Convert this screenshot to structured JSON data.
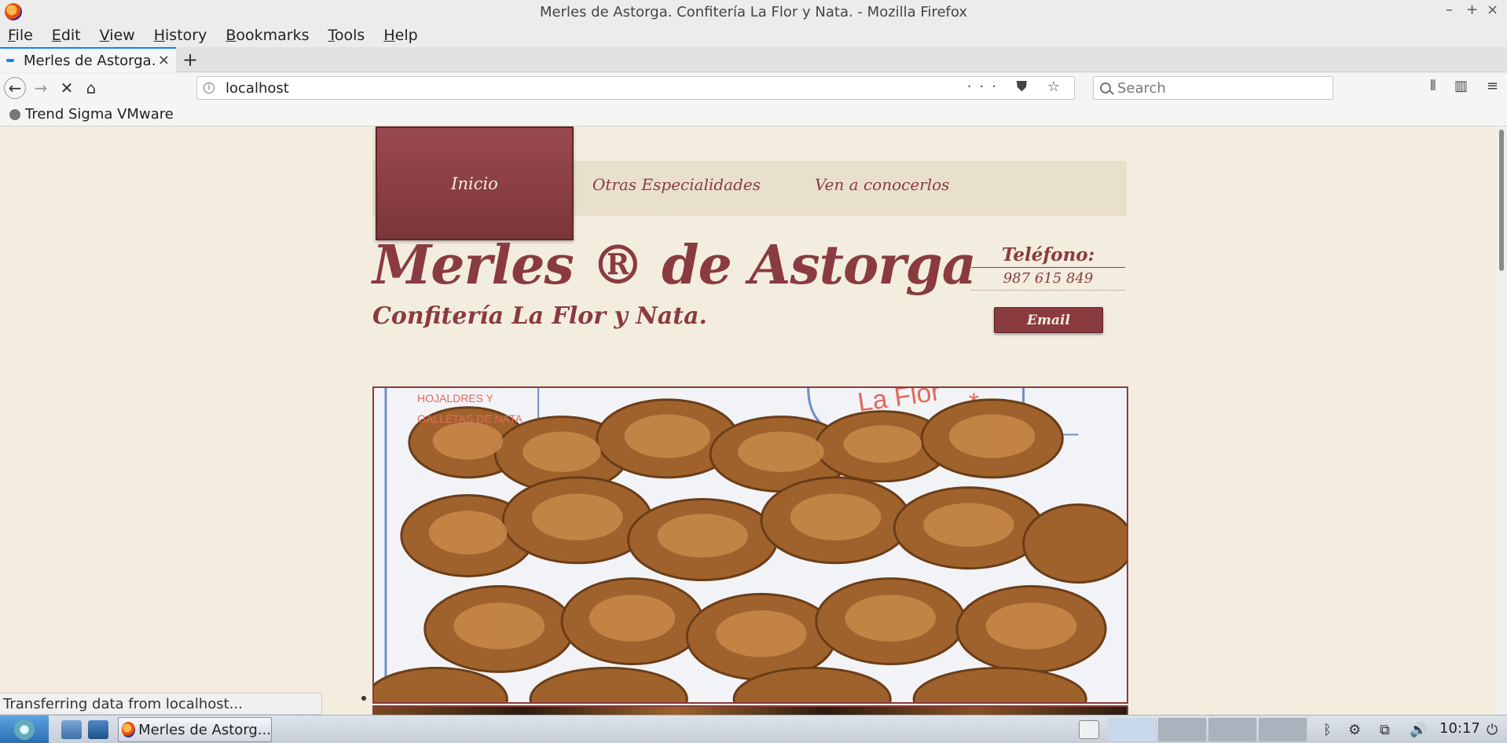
{
  "window": {
    "title": "Merles de Astorga. Confitería La Flor y Nata. - Mozilla Firefox",
    "controls": [
      "–",
      "+",
      "×"
    ]
  },
  "menu": [
    {
      "key": "F",
      "rest": "ile"
    },
    {
      "key": "E",
      "rest": "dit"
    },
    {
      "key": "V",
      "rest": "iew"
    },
    {
      "key": "H",
      "rest": "istory"
    },
    {
      "key": "B",
      "rest": "ookmarks"
    },
    {
      "key": "T",
      "rest": "ools"
    },
    {
      "key": "H",
      "rest": "elp"
    }
  ],
  "tab": {
    "label": "Merles de Astorga. Confitería La Flor y Nata.",
    "close": "×",
    "new_tab": "+"
  },
  "nav": {
    "back": "←",
    "forward": "→",
    "stop": "✕",
    "home": "⌂"
  },
  "urlbar": {
    "url": "localhost",
    "actions": "··· ⛊ ☆"
  },
  "search": {
    "placeholder": "Search"
  },
  "toolbar_right": {
    "library": "⫴",
    "sidebar": "▥",
    "menu": "≡"
  },
  "bookmarks": [
    {
      "label": "Trend Sigma VMware"
    }
  ],
  "page": {
    "nav_items": [
      "Inicio",
      "Otras Especialidades",
      "Ven a conocerlos"
    ],
    "active_nav": "Inicio",
    "site_title": "Merles ®  de Astorga",
    "site_subtitle": "Confitería La Flor y Nata.",
    "phone_label": "Teléfono:",
    "phone_number": "987 615 849",
    "email_button": "Email",
    "hero_caption_line1": "HOJALDRES Y",
    "hero_caption_line2": "GALLETAS DE NATA"
  },
  "status": "Transferring data from localhost...",
  "taskbar": {
    "task_label": "Merles de Astorg...",
    "clock": "10:17"
  },
  "colors": {
    "brand": "#8a3b3f",
    "page_bg": "#f3ede0",
    "nav_bg": "#e9e0cc",
    "accent": "#0a84ff"
  }
}
